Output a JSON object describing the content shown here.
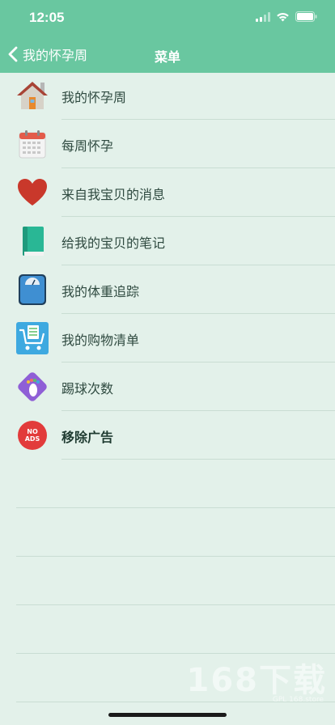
{
  "status_bar": {
    "time": "12:05"
  },
  "nav": {
    "back_label": "我的怀孕周",
    "title": "菜单"
  },
  "menu": [
    {
      "label": "我的怀孕周",
      "icon": "house-icon",
      "bold": false
    },
    {
      "label": "每周怀孕",
      "icon": "calendar-icon",
      "bold": false
    },
    {
      "label": "来自我宝贝的消息",
      "icon": "heart-icon",
      "bold": false
    },
    {
      "label": "给我的宝贝的笔记",
      "icon": "notebook-icon",
      "bold": false
    },
    {
      "label": "我的体重追踪",
      "icon": "scale-icon",
      "bold": false
    },
    {
      "label": "我的购物清单",
      "icon": "shopping-cart-icon",
      "bold": false
    },
    {
      "label": "踢球次数",
      "icon": "footprint-icon",
      "bold": false
    },
    {
      "label": "移除广告",
      "icon": "no-ads-icon",
      "bold": true
    }
  ],
  "no_ads_badge": {
    "line1": "NO",
    "line2": "ADS"
  },
  "watermark": {
    "main": "168下载",
    "sub": "GPL 168.store"
  },
  "colors": {
    "header": "#69c7a0",
    "background": "#e3f1ea"
  }
}
